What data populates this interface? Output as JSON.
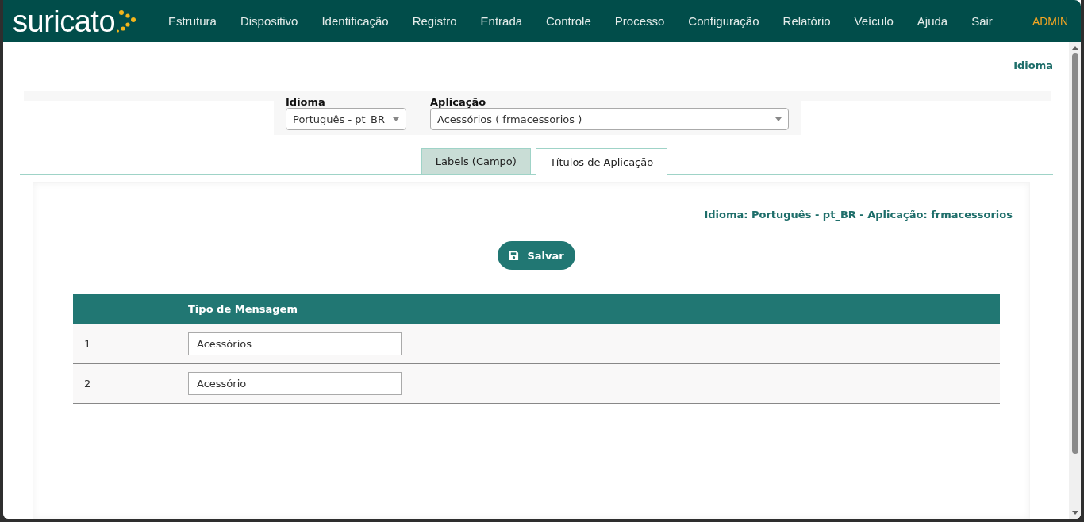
{
  "header": {
    "logo": "suricato",
    "menu": [
      "Estrutura",
      "Dispositivo",
      "Identificação",
      "Registro",
      "Entrada",
      "Controle",
      "Processo",
      "Configuração",
      "Relatório",
      "Veículo",
      "Ajuda",
      "Sair"
    ],
    "user": "ADMIN"
  },
  "page_title": "Idioma",
  "filters": [
    {
      "label": "Idioma",
      "value": "Português - pt_BR"
    },
    {
      "label": "Aplicação",
      "value": "Acessórios ( frmacessorios )"
    }
  ],
  "tabs": [
    {
      "label": "Labels (Campo)",
      "selected": false
    },
    {
      "label": "Títulos de Aplicação",
      "selected": true
    }
  ],
  "info": "Idioma: Português - pt_BR - Aplicação: frmacessorios",
  "save_button": "Salvar",
  "table": {
    "columns": [
      "Tipo de Mensagem"
    ],
    "rows": [
      {
        "number": "1",
        "value": "Acessórios"
      },
      {
        "number": "2",
        "value": "Acessório"
      }
    ]
  }
}
